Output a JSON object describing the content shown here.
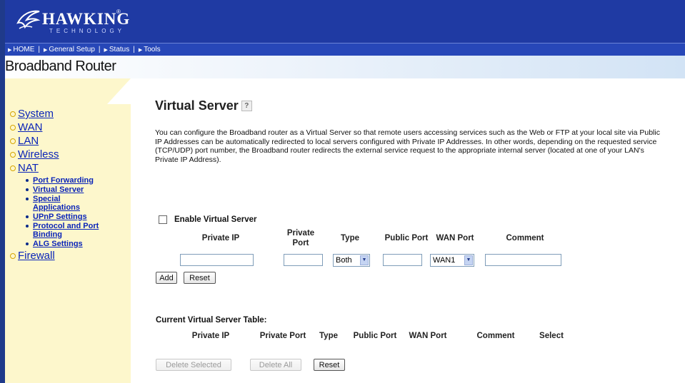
{
  "brand": {
    "name": "HAWKING",
    "sub": "TECHNOLOGY",
    "reg": "®"
  },
  "nav": [
    {
      "label": "HOME"
    },
    {
      "label": "General Setup"
    },
    {
      "label": "Status"
    },
    {
      "label": "Tools"
    }
  ],
  "band_title": "Broadband Router",
  "sidebar": {
    "items": [
      {
        "label": "System"
      },
      {
        "label": "WAN"
      },
      {
        "label": "LAN"
      },
      {
        "label": "Wireless"
      },
      {
        "label": "NAT"
      },
      {
        "label": "Firewall"
      }
    ],
    "nat_sub": [
      {
        "label": "Port Forwarding"
      },
      {
        "label": "Virtual Server"
      },
      {
        "label": "Special Applications"
      },
      {
        "label": "UPnP Settings"
      },
      {
        "label": "Protocol and Port Binding"
      },
      {
        "label": "ALG Settings"
      }
    ]
  },
  "page": {
    "title": "Virtual Server",
    "help": "?",
    "description": "You can configure the Broadband router as a Virtual Server so that remote users accessing services such as the Web or FTP at your local site via Public IP Addresses can be automatically redirected to local servers configured with Private IP Addresses. In other words, depending on the requested service (TCP/UDP) port number, the Broadband router redirects the external service request to the appropriate internal server (located at one of your LAN's Private IP Address).",
    "enable_label": "Enable Virtual Server"
  },
  "form": {
    "headers": {
      "private_ip": "Private IP",
      "private_port": "Private Port",
      "type": "Type",
      "public_port": "Public Port",
      "wan_port": "WAN Port",
      "comment": "Comment"
    },
    "values": {
      "private_ip": "",
      "private_port": "",
      "type": "Both",
      "public_port": "",
      "wan_port": "WAN1",
      "comment": ""
    },
    "buttons": {
      "add": "Add",
      "reset": "Reset"
    }
  },
  "table": {
    "title": "Current Virtual Server Table:",
    "headers": {
      "private_ip": "Private IP",
      "private_port": "Private Port",
      "type": "Type",
      "public_port": "Public Port",
      "wan_port": "WAN Port",
      "comment": "Comment",
      "select": "Select"
    },
    "buttons": {
      "delete_selected": "Delete Selected",
      "delete_all": "Delete All",
      "reset": "Reset"
    }
  },
  "colors": {
    "header_blue": "#1f3aa3",
    "sidebar_yellow": "#fdf7cc",
    "link_blue": "#0a24b8"
  }
}
